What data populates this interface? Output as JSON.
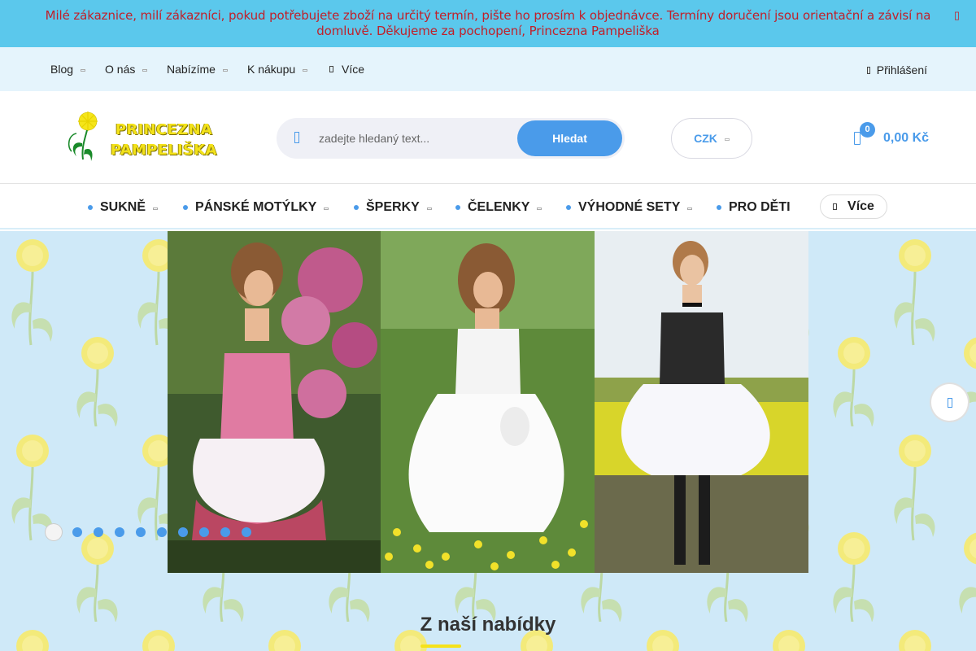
{
  "announcement": {
    "text": "Milé zákaznice, milí zákazníci, pokud potřebujete zboží na určitý termín, pište ho prosím k objednávce. Termíny doručení jsou orientační a závisí na domluvě. Děkujeme za pochopení, Princezna Pampeliška",
    "close_icon": "close-icon"
  },
  "topnav": {
    "items": [
      {
        "label": "Blog",
        "has_dropdown": true
      },
      {
        "label": "O nás",
        "has_dropdown": true
      },
      {
        "label": "Nabízíme",
        "has_dropdown": true
      },
      {
        "label": "K nákupu",
        "has_dropdown": true
      }
    ],
    "more_label": "Více",
    "login_label": "Přihlášení"
  },
  "header": {
    "logo": {
      "line1": "PRINCEZNA",
      "line2": "PAMPELIŠKA"
    },
    "search": {
      "placeholder": "zadejte hledaný text...",
      "button_label": "Hledat"
    },
    "currency": "CZK",
    "cart": {
      "count": "0",
      "total": "0,00 Kč"
    }
  },
  "categories": {
    "items": [
      {
        "label": "SUKNĚ",
        "has_dropdown": true
      },
      {
        "label": "PÁNSKÉ MOTÝLKY",
        "has_dropdown": true
      },
      {
        "label": "ŠPERKY",
        "has_dropdown": true
      },
      {
        "label": "ČELENKY",
        "has_dropdown": true
      },
      {
        "label": "VÝHODNÉ SETY",
        "has_dropdown": true
      },
      {
        "label": "PRO DĚTI",
        "has_dropdown": false
      }
    ],
    "more_label": "Více"
  },
  "slider": {
    "slide_count": 10,
    "active_index": 0,
    "next_icon": "chevron-right-icon"
  },
  "section": {
    "title": "Z naší nabídky"
  },
  "colors": {
    "accent": "#4a9bea",
    "announcement_bg": "#5bc8ec",
    "announcement_text": "#c0202a",
    "topnav_bg": "#e5f4fc",
    "hero_bg": "#cfe9f8",
    "logo_yellow": "#f3e21a"
  }
}
